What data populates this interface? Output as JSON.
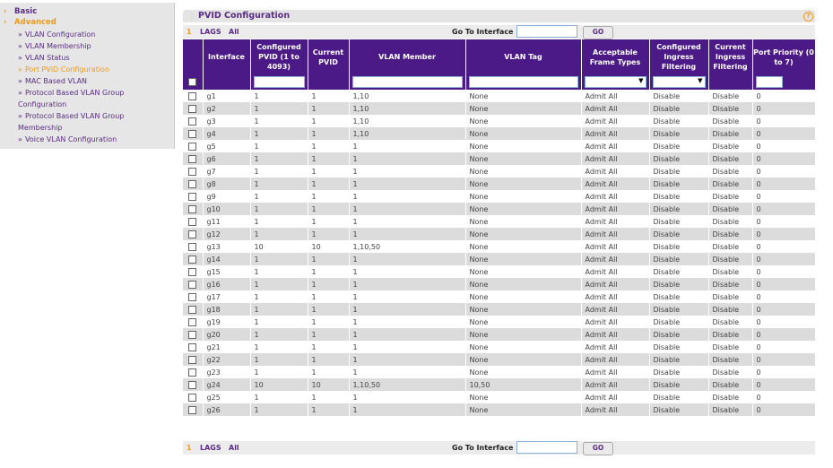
{
  "sidebar": {
    "categories": [
      {
        "label": "Basic",
        "active": false
      },
      {
        "label": "Advanced",
        "active": true
      }
    ],
    "items": [
      {
        "label": "VLAN Configuration"
      },
      {
        "label": "VLAN Membership"
      },
      {
        "label": "VLAN Status"
      },
      {
        "label": "Port PVID Configuration"
      },
      {
        "label": "MAC Based VLAN"
      },
      {
        "label": "Protocol Based VLAN Group Configuration"
      },
      {
        "label": "Protocol Based VLAN Group Membership"
      },
      {
        "label": "Voice VLAN Configuration"
      }
    ],
    "bullet": "»",
    "arrow": "›"
  },
  "panel": {
    "title": "PVID Configuration",
    "help": "?",
    "nav": {
      "unit": "1",
      "lags": "LAGS",
      "all": "All",
      "goto_label": "Go To Interface",
      "goto_value": "",
      "go_button": "GO"
    }
  },
  "table": {
    "headers": {
      "interface": "Interface",
      "configured_pvid": "Configured PVID (1 to 4093)",
      "current_pvid": "Current PVID",
      "vlan_member": "VLAN Member",
      "vlan_tag": "VLAN Tag",
      "acceptable_frame_types": "Acceptable Frame Types",
      "configured_ingress_filtering": "Configured Ingress Filtering",
      "current_ingress_filtering": "Current Ingress Filtering",
      "port_priority": "Port Priority (0 to 7)"
    },
    "rows": [
      {
        "interface": "g1",
        "configured_pvid": "1",
        "current_pvid": "1",
        "vlan_member": "1,10",
        "vlan_tag": "None",
        "frame_types": "Admit All",
        "cfg_ingress": "Disable",
        "cur_ingress": "Disable",
        "priority": "0"
      },
      {
        "interface": "g2",
        "configured_pvid": "1",
        "current_pvid": "1",
        "vlan_member": "1,10",
        "vlan_tag": "None",
        "frame_types": "Admit All",
        "cfg_ingress": "Disable",
        "cur_ingress": "Disable",
        "priority": "0"
      },
      {
        "interface": "g3",
        "configured_pvid": "1",
        "current_pvid": "1",
        "vlan_member": "1,10",
        "vlan_tag": "None",
        "frame_types": "Admit All",
        "cfg_ingress": "Disable",
        "cur_ingress": "Disable",
        "priority": "0"
      },
      {
        "interface": "g4",
        "configured_pvid": "1",
        "current_pvid": "1",
        "vlan_member": "1,10",
        "vlan_tag": "None",
        "frame_types": "Admit All",
        "cfg_ingress": "Disable",
        "cur_ingress": "Disable",
        "priority": "0"
      },
      {
        "interface": "g5",
        "configured_pvid": "1",
        "current_pvid": "1",
        "vlan_member": "1",
        "vlan_tag": "None",
        "frame_types": "Admit All",
        "cfg_ingress": "Disable",
        "cur_ingress": "Disable",
        "priority": "0"
      },
      {
        "interface": "g6",
        "configured_pvid": "1",
        "current_pvid": "1",
        "vlan_member": "1",
        "vlan_tag": "None",
        "frame_types": "Admit All",
        "cfg_ingress": "Disable",
        "cur_ingress": "Disable",
        "priority": "0"
      },
      {
        "interface": "g7",
        "configured_pvid": "1",
        "current_pvid": "1",
        "vlan_member": "1",
        "vlan_tag": "None",
        "frame_types": "Admit All",
        "cfg_ingress": "Disable",
        "cur_ingress": "Disable",
        "priority": "0"
      },
      {
        "interface": "g8",
        "configured_pvid": "1",
        "current_pvid": "1",
        "vlan_member": "1",
        "vlan_tag": "None",
        "frame_types": "Admit All",
        "cfg_ingress": "Disable",
        "cur_ingress": "Disable",
        "priority": "0"
      },
      {
        "interface": "g9",
        "configured_pvid": "1",
        "current_pvid": "1",
        "vlan_member": "1",
        "vlan_tag": "None",
        "frame_types": "Admit All",
        "cfg_ingress": "Disable",
        "cur_ingress": "Disable",
        "priority": "0"
      },
      {
        "interface": "g10",
        "configured_pvid": "1",
        "current_pvid": "1",
        "vlan_member": "1",
        "vlan_tag": "None",
        "frame_types": "Admit All",
        "cfg_ingress": "Disable",
        "cur_ingress": "Disable",
        "priority": "0"
      },
      {
        "interface": "g11",
        "configured_pvid": "1",
        "current_pvid": "1",
        "vlan_member": "1",
        "vlan_tag": "None",
        "frame_types": "Admit All",
        "cfg_ingress": "Disable",
        "cur_ingress": "Disable",
        "priority": "0"
      },
      {
        "interface": "g12",
        "configured_pvid": "1",
        "current_pvid": "1",
        "vlan_member": "1",
        "vlan_tag": "None",
        "frame_types": "Admit All",
        "cfg_ingress": "Disable",
        "cur_ingress": "Disable",
        "priority": "0"
      },
      {
        "interface": "g13",
        "configured_pvid": "10",
        "current_pvid": "10",
        "vlan_member": "1,10,50",
        "vlan_tag": "None",
        "frame_types": "Admit All",
        "cfg_ingress": "Disable",
        "cur_ingress": "Disable",
        "priority": "0"
      },
      {
        "interface": "g14",
        "configured_pvid": "1",
        "current_pvid": "1",
        "vlan_member": "1",
        "vlan_tag": "None",
        "frame_types": "Admit All",
        "cfg_ingress": "Disable",
        "cur_ingress": "Disable",
        "priority": "0"
      },
      {
        "interface": "g15",
        "configured_pvid": "1",
        "current_pvid": "1",
        "vlan_member": "1",
        "vlan_tag": "None",
        "frame_types": "Admit All",
        "cfg_ingress": "Disable",
        "cur_ingress": "Disable",
        "priority": "0"
      },
      {
        "interface": "g16",
        "configured_pvid": "1",
        "current_pvid": "1",
        "vlan_member": "1",
        "vlan_tag": "None",
        "frame_types": "Admit All",
        "cfg_ingress": "Disable",
        "cur_ingress": "Disable",
        "priority": "0"
      },
      {
        "interface": "g17",
        "configured_pvid": "1",
        "current_pvid": "1",
        "vlan_member": "1",
        "vlan_tag": "None",
        "frame_types": "Admit All",
        "cfg_ingress": "Disable",
        "cur_ingress": "Disable",
        "priority": "0"
      },
      {
        "interface": "g18",
        "configured_pvid": "1",
        "current_pvid": "1",
        "vlan_member": "1",
        "vlan_tag": "None",
        "frame_types": "Admit All",
        "cfg_ingress": "Disable",
        "cur_ingress": "Disable",
        "priority": "0"
      },
      {
        "interface": "g19",
        "configured_pvid": "1",
        "current_pvid": "1",
        "vlan_member": "1",
        "vlan_tag": "None",
        "frame_types": "Admit All",
        "cfg_ingress": "Disable",
        "cur_ingress": "Disable",
        "priority": "0"
      },
      {
        "interface": "g20",
        "configured_pvid": "1",
        "current_pvid": "1",
        "vlan_member": "1",
        "vlan_tag": "None",
        "frame_types": "Admit All",
        "cfg_ingress": "Disable",
        "cur_ingress": "Disable",
        "priority": "0"
      },
      {
        "interface": "g21",
        "configured_pvid": "1",
        "current_pvid": "1",
        "vlan_member": "1",
        "vlan_tag": "None",
        "frame_types": "Admit All",
        "cfg_ingress": "Disable",
        "cur_ingress": "Disable",
        "priority": "0"
      },
      {
        "interface": "g22",
        "configured_pvid": "1",
        "current_pvid": "1",
        "vlan_member": "1",
        "vlan_tag": "None",
        "frame_types": "Admit All",
        "cfg_ingress": "Disable",
        "cur_ingress": "Disable",
        "priority": "0"
      },
      {
        "interface": "g23",
        "configured_pvid": "1",
        "current_pvid": "1",
        "vlan_member": "1",
        "vlan_tag": "None",
        "frame_types": "Admit All",
        "cfg_ingress": "Disable",
        "cur_ingress": "Disable",
        "priority": "0"
      },
      {
        "interface": "g24",
        "configured_pvid": "10",
        "current_pvid": "10",
        "vlan_member": "1,10,50",
        "vlan_tag": "10,50",
        "frame_types": "Admit All",
        "cfg_ingress": "Disable",
        "cur_ingress": "Disable",
        "priority": "0"
      },
      {
        "interface": "g25",
        "configured_pvid": "1",
        "current_pvid": "1",
        "vlan_member": "1",
        "vlan_tag": "None",
        "frame_types": "Admit All",
        "cfg_ingress": "Disable",
        "cur_ingress": "Disable",
        "priority": "0"
      },
      {
        "interface": "g26",
        "configured_pvid": "1",
        "current_pvid": "1",
        "vlan_member": "1",
        "vlan_tag": "None",
        "frame_types": "Admit All",
        "cfg_ingress": "Disable",
        "cur_ingress": "Disable",
        "priority": "0"
      }
    ]
  },
  "colors": {
    "brand_purple": "#4b1a86",
    "accent_orange": "#f09a1c",
    "row_alt": "#dcdcdc"
  }
}
